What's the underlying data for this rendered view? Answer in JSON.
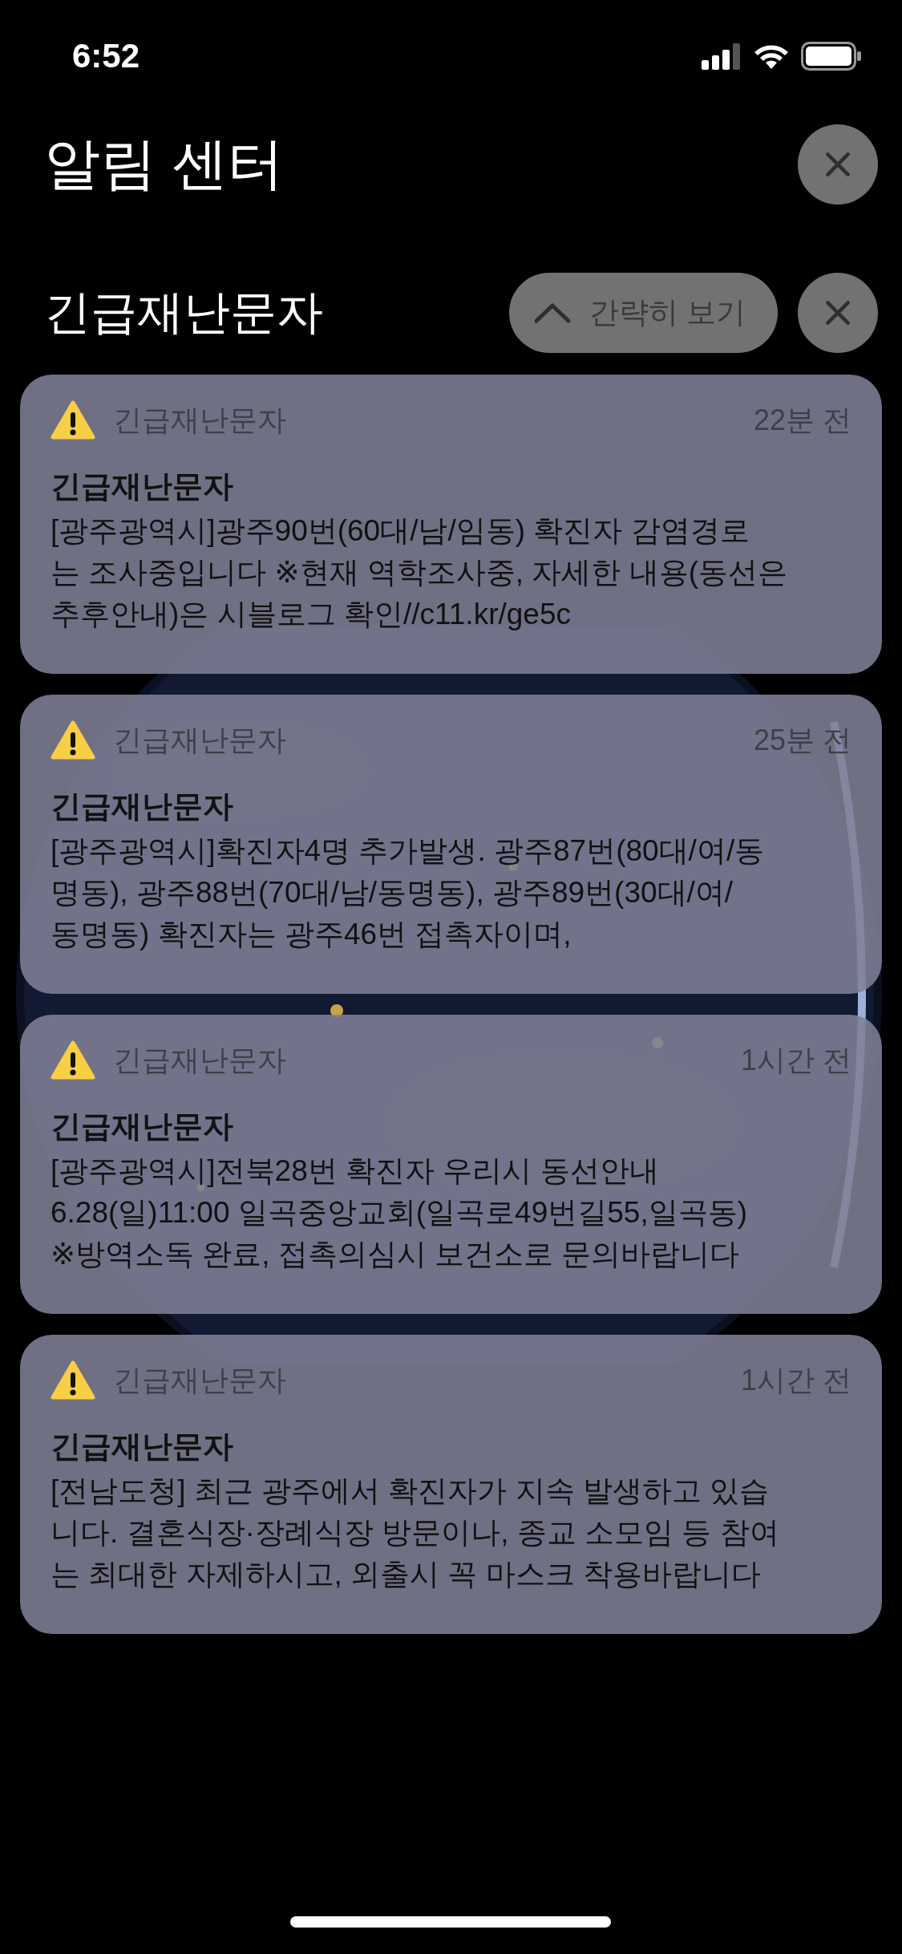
{
  "status_bar": {
    "time": "6:52"
  },
  "header": {
    "title": "알림 센터"
  },
  "group": {
    "title": "긴급재난문자",
    "collapse_label": "간략히 보기"
  },
  "notifications": [
    {
      "app": "긴급재난문자",
      "time": "22분 전",
      "title": "긴급재난문자",
      "body": "[광주광역시]광주90번(60대/남/임동) 확진자 감염경로\n는 조사중입니다 ※현재 역학조사중, 자세한 내용(동선은\n추후안내)은 시블로그 확인//c11.kr/ge5c"
    },
    {
      "app": "긴급재난문자",
      "time": "25분 전",
      "title": "긴급재난문자",
      "body": "[광주광역시]확진자4명 추가발생. 광주87번(80대/여/동\n명동), 광주88번(70대/남/동명동), 광주89번(30대/여/\n동명동) 확진자는 광주46번 접촉자이며,"
    },
    {
      "app": "긴급재난문자",
      "time": "1시간 전",
      "title": "긴급재난문자",
      "body": "[광주광역시]전북28번 확진자 우리시 동선안내\n6.28(일)11:00 일곡중앙교회(일곡로49번길55,일곡동)\n※방역소독 완료, 접촉의심시 보건소로 문의바랍니다"
    },
    {
      "app": "긴급재난문자",
      "time": "1시간 전",
      "title": "긴급재난문자",
      "body": "[전남도청] 최근 광주에서 확진자가 지속 발생하고 있습\n니다. 결혼식장·장례식장 방문이나, 종교 소모임 등 참여\n는 최대한 자제하시고, 외출시 꼭 마스크 착용바랍니다"
    }
  ]
}
